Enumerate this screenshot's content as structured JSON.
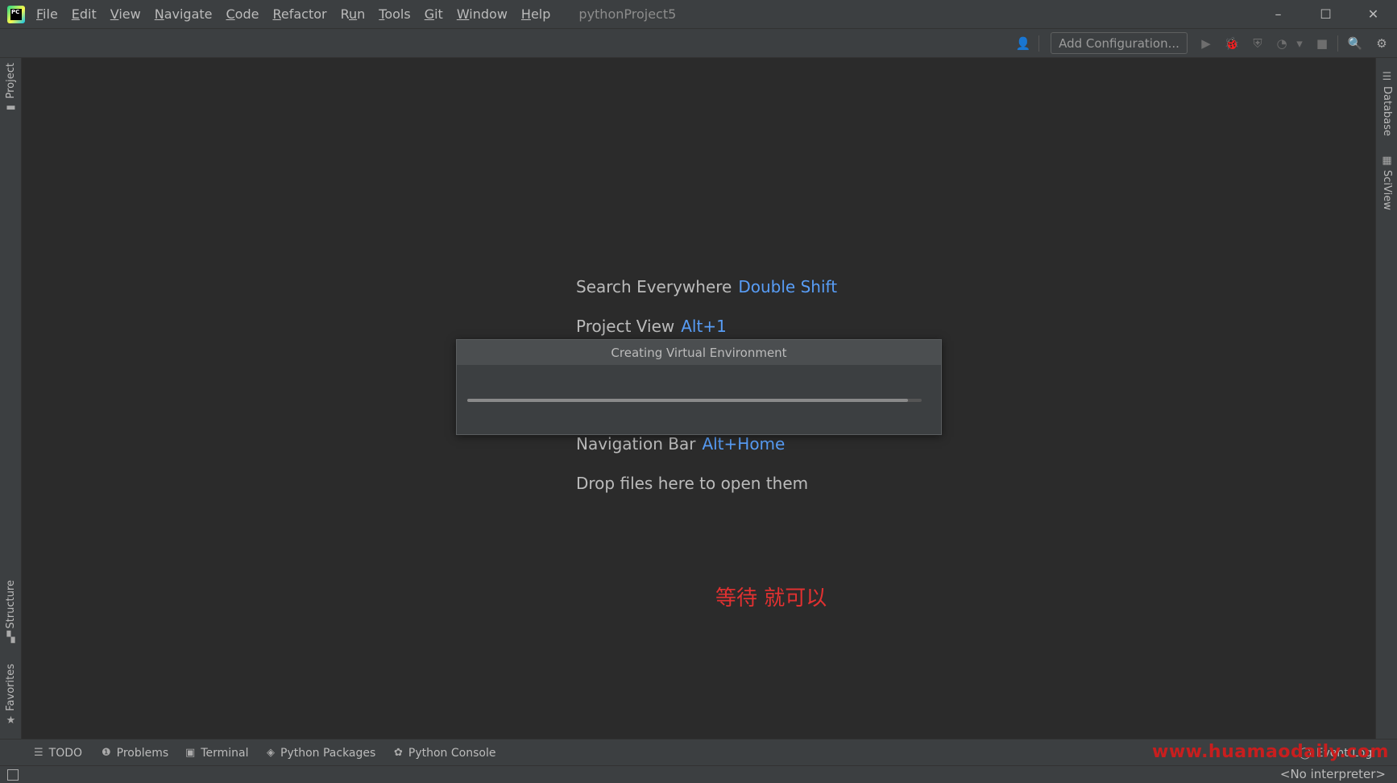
{
  "app": {
    "logo_text": "PC",
    "project_name": "pythonProject5"
  },
  "menu": [
    {
      "pre": "",
      "mnemonic": "F",
      "post": "ile"
    },
    {
      "pre": "",
      "mnemonic": "E",
      "post": "dit"
    },
    {
      "pre": "",
      "mnemonic": "V",
      "post": "iew"
    },
    {
      "pre": "",
      "mnemonic": "N",
      "post": "avigate"
    },
    {
      "pre": "",
      "mnemonic": "C",
      "post": "ode"
    },
    {
      "pre": "",
      "mnemonic": "R",
      "post": "efactor"
    },
    {
      "pre": "R",
      "mnemonic": "u",
      "post": "n"
    },
    {
      "pre": "",
      "mnemonic": "T",
      "post": "ools"
    },
    {
      "pre": "",
      "mnemonic": "G",
      "post": "it"
    },
    {
      "pre": "",
      "mnemonic": "W",
      "post": "indow"
    },
    {
      "pre": "",
      "mnemonic": "H",
      "post": "elp"
    }
  ],
  "window_controls": {
    "minimize": "–",
    "maximize": "☐",
    "close": "✕"
  },
  "toolbar": {
    "add_configuration": "Add Configuration...",
    "icons": {
      "user": "👤",
      "run": "▶",
      "debug": "🐞",
      "coverage": "⛨",
      "profile": "◔",
      "more": "▾",
      "stop": "■",
      "search": "🔍",
      "settings": "⚙"
    }
  },
  "left_tabs": {
    "project": "Project",
    "structure": "Structure",
    "favorites": "Favorites"
  },
  "right_tabs": {
    "database": "Database",
    "sciview": "SciView"
  },
  "hints": {
    "search_everywhere": {
      "label": "Search Everywhere",
      "shortcut": "Double Shift"
    },
    "project_view": {
      "label": "Project View",
      "shortcut": "Alt+1"
    },
    "navigation_bar": {
      "label": "Navigation Bar",
      "shortcut": "Alt+Home"
    },
    "drop_files": "Drop files here to open them"
  },
  "dialog": {
    "title": "Creating Virtual Environment",
    "progress": 0.97
  },
  "annotation": "等待 就可以",
  "bottom_tabs": {
    "todo": "TODO",
    "problems": "Problems",
    "terminal": "Terminal",
    "python_packages": "Python Packages",
    "python_console": "Python Console",
    "event_log": "Event Log"
  },
  "watermark": "www.huamaodaily.com",
  "status": {
    "interpreter": "<No interpreter>"
  }
}
